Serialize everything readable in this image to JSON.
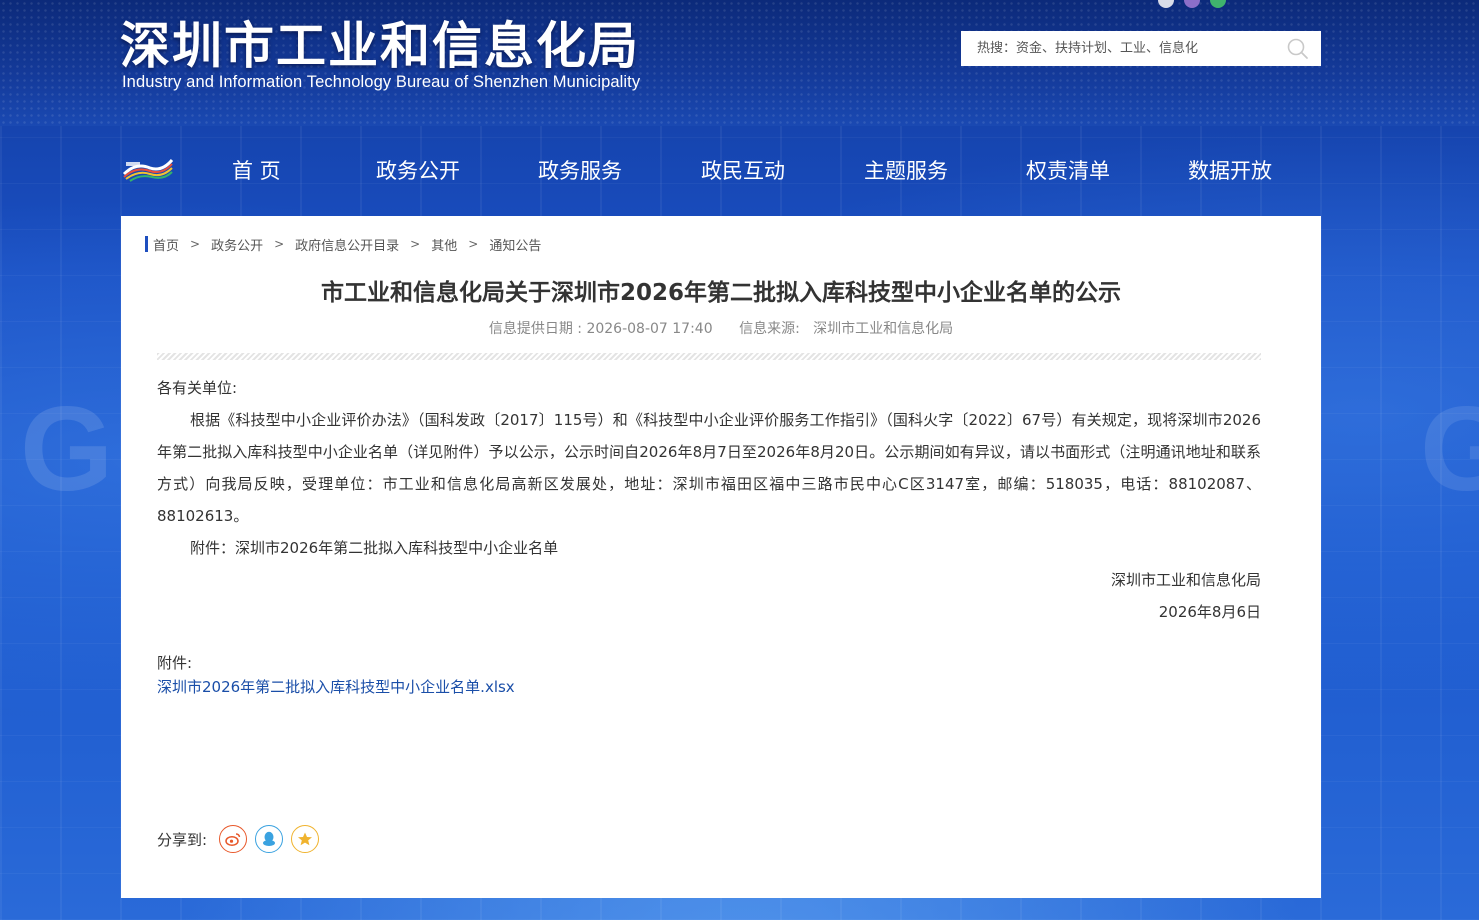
{
  "header": {
    "logo_cn": "深圳市工业和信息化局",
    "logo_en": "Industry and Information Technology Bureau of Shenzhen Municipality",
    "search_placeholder": "热搜：资金、扶持计划、工业、信息化"
  },
  "nav": {
    "items": [
      "首 页",
      "政务公开",
      "政务服务",
      "政民互动",
      "主题服务",
      "权责清单",
      "数据开放"
    ]
  },
  "breadcrumb": [
    "首页",
    "政务公开",
    "政府信息公开目录",
    "其他",
    "通知公告"
  ],
  "breadcrumb_sep": ">",
  "article": {
    "title": "市工业和信息化局关于深圳市2026年第二批拟入库科技型中小企业名单的公示",
    "date_label": "信息提供日期 : 2026-08-07 17:40",
    "source_label": "信息来源:   深圳市工业和信息化局",
    "salutation": "各有关单位:",
    "paragraph": "根据《科技型中小企业评价办法》（国科发政〔2017〕115号）和《科技型中小企业评价服务工作指引》（国科火字〔2022〕67号）有关规定，现将深圳市2026年第二批拟入库科技型中小企业名单（详见附件）予以公示，公示时间自2026年8月7日至2026年8月20日。公示期间如有异议，请以书面形式（注明通讯地址和联系方式）向我局反映，受理单位：市工业和信息化局高新区发展处，地址：深圳市福田区福中三路市民中心C区3147室，邮编：518035，电话：88102087、88102613。",
    "attachment_line": "附件：深圳市2026年第二批拟入库科技型中小企业名单",
    "signature": "深圳市工业和信息化局",
    "sign_date": "2026年8月6日"
  },
  "attachments": {
    "label": "附件:",
    "file": "深圳市2026年第二批拟入库科技型中小企业名单.xlsx"
  },
  "share": {
    "label": "分享到:",
    "icons": [
      "weibo-icon",
      "qq-icon",
      "qzone-icon"
    ]
  },
  "colors": {
    "brand_blue": "#1e4fbf",
    "link": "#1a4ea8",
    "weibo": "#e8582a",
    "qq": "#3aa2e0",
    "qzone": "#f0b32e"
  }
}
